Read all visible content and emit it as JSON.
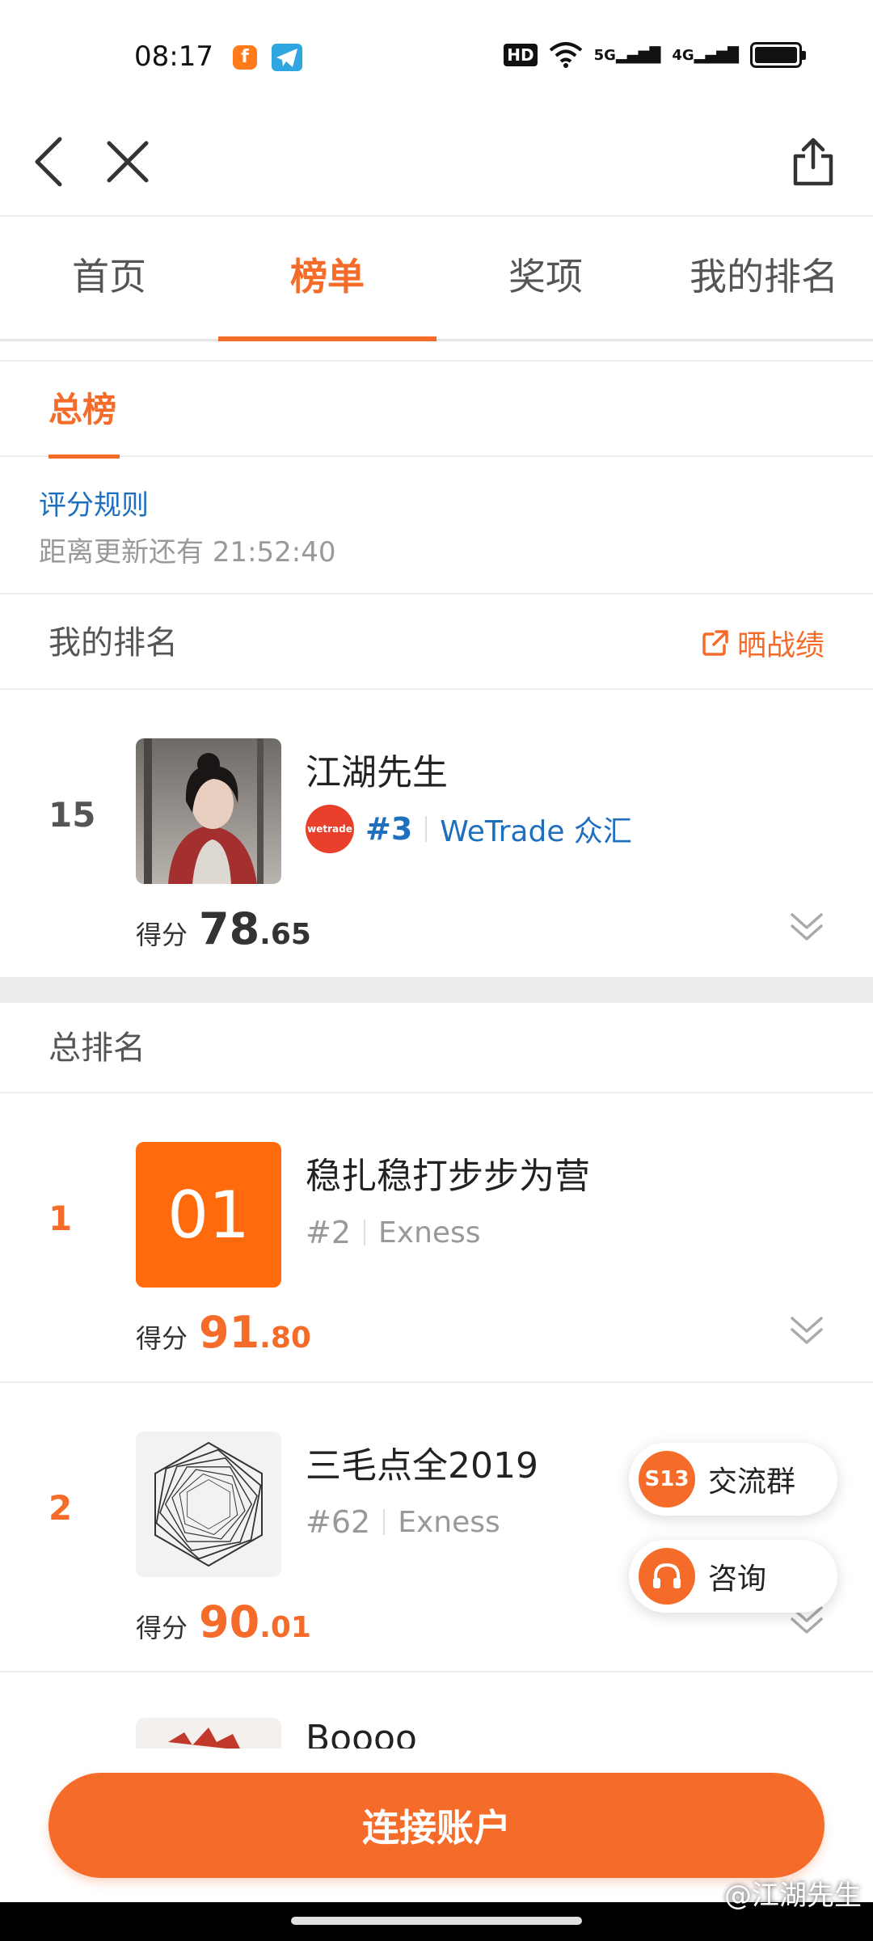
{
  "status_bar": {
    "time": "08:17",
    "hd": "HD",
    "net1": "5G",
    "net2": "4G"
  },
  "tabs": [
    {
      "label": "首页"
    },
    {
      "label": "榜单"
    },
    {
      "label": "奖项"
    },
    {
      "label": "我的排名"
    }
  ],
  "subtab": "总榜",
  "rules": {
    "link": "评分规则",
    "countdown": "距离更新还有 21:52:40"
  },
  "my_rank": {
    "section_title": "我的排名",
    "share_label": "晒战绩",
    "rank": "15",
    "name": "江湖先生",
    "broker_rank": "#3",
    "broker": "WeTrade 众汇",
    "broker_logo_text": "wetrade",
    "score_label": "得分",
    "score_int": "78",
    "score_dec": ".65"
  },
  "overall": {
    "section_title": "总排名",
    "entries": [
      {
        "rank": "1",
        "name": "稳扎稳打步步为营",
        "avatar_text": "01",
        "broker_rank": "#2",
        "broker": "Exness",
        "score_label": "得分",
        "score_int": "91",
        "score_dec": ".80"
      },
      {
        "rank": "2",
        "name": "三毛点全2019",
        "broker_rank": "#62",
        "broker": "Exness",
        "score_label": "得分",
        "score_int": "90",
        "score_dec": ".01"
      },
      {
        "name": "Boooo"
      }
    ]
  },
  "floating": {
    "group_icon": "S13",
    "group_label": "交流群",
    "consult_label": "咨询"
  },
  "connect_button": "连接账户",
  "watermark": "@江湖先生",
  "colors": {
    "accent": "#f56b2a",
    "link": "#1f6fbf"
  }
}
